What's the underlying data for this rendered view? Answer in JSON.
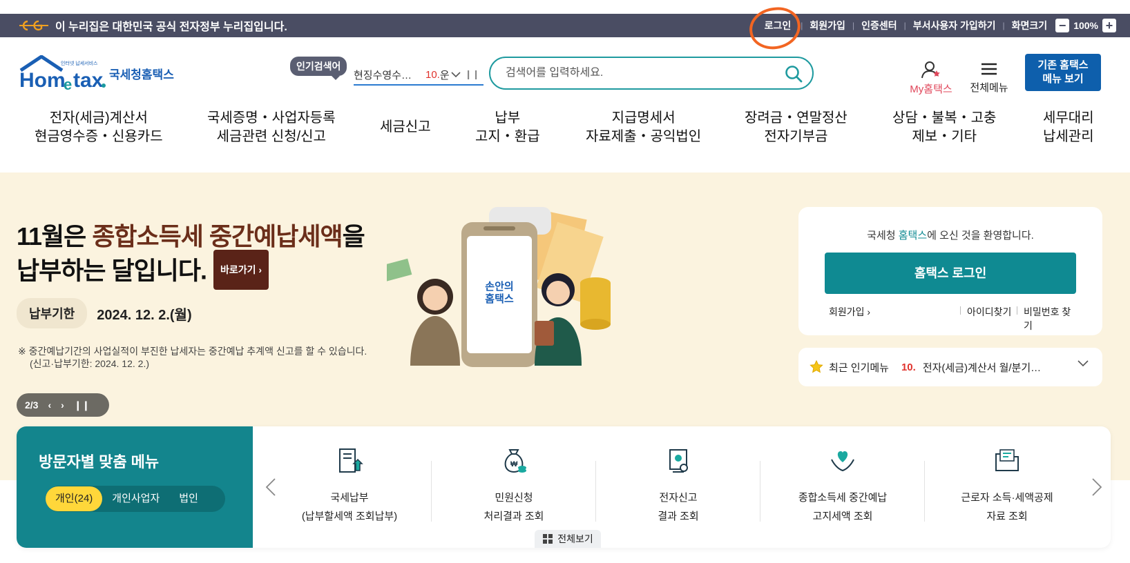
{
  "gov_banner": {
    "text": "이 누리집은 대한민국 공식 전자정부 누리집입니다.",
    "links": [
      "로그인",
      "회원가입",
      "인증센터",
      "부서사용자 가입하기",
      "화면크기"
    ],
    "zoom": "100%",
    "zoom_minus": "−",
    "zoom_plus": "+"
  },
  "header": {
    "popular_label": "인기검색어",
    "popular_current_text": "현징수영수…",
    "popular_current_rank": "10.",
    "popular_current_extra": "운",
    "search_placeholder": "검색어를 입력하세요.",
    "my_hometax": "My홈택스",
    "all_menu": "전체메뉴",
    "old_menu_line1": "기존 홈택스",
    "old_menu_line2": "메뉴 보기"
  },
  "main_nav": [
    {
      "l1": "전자(세금)계산서",
      "l2": "현금영수증・신용카드"
    },
    {
      "l1": "국세증명・사업자등록",
      "l2": "세금관련 신청/신고"
    },
    {
      "l1": "세금신고",
      "l2": ""
    },
    {
      "l1": "납부",
      "l2": "고지・환급"
    },
    {
      "l1": "지급명세서",
      "l2": "자료제출・공익법인"
    },
    {
      "l1": "장려금・연말정산",
      "l2": "전자기부금"
    },
    {
      "l1": "상담・불복・고충",
      "l2": "제보・기타"
    },
    {
      "l1": "세무대리",
      "l2": "납세관리"
    }
  ],
  "hero": {
    "title_line1_a": "11월은 ",
    "title_line1_b": "종합소득세 중간예납세액",
    "title_line1_c": "을",
    "title_line2": "납부하는 달입니다.",
    "go_label": "바로가기",
    "deadline_label": "납부기한",
    "deadline_value": "2024. 12. 2.(월)",
    "note_line1": "※ 중간예납기간의 사업실적이 부진한 납세자는 중간예납 추계액 신고를 할 수 있습니다.",
    "note_line2": "(신고·납부기한: 2024. 12. 2.)",
    "slide_counter": "2/3",
    "phone_text_1": "손안의",
    "phone_text_2": "홈택스"
  },
  "login_panel": {
    "welcome_a": "국세청 ",
    "welcome_b": "홈택스",
    "welcome_c": "에 오신 것을 환영합니다.",
    "login_button": "홈택스 로그인",
    "join": "회원가입",
    "find_id": "아이디찾기",
    "find_pw": "비밀번호 찾기"
  },
  "popular_menu": {
    "label": "최근 인기메뉴",
    "rank": "10.",
    "text": "전자(세금)계산서 월/분기…"
  },
  "visitor_menu": {
    "title": "방문자별 맞춤 메뉴",
    "tabs": [
      "개인(24)",
      "개인사업자",
      "법인"
    ],
    "services": [
      {
        "l1": "국세납부",
        "l2": "(납부할세액 조회납부)",
        "icon": "tax-payment-icon"
      },
      {
        "l1": "민원신청",
        "l2": "처리결과 조회",
        "icon": "money-bag-icon"
      },
      {
        "l1": "전자신고",
        "l2": "결과 조회",
        "icon": "certificate-icon"
      },
      {
        "l1": "종합소득세 중간예납",
        "l2": "고지세액 조회",
        "icon": "heart-hands-icon"
      },
      {
        "l1": "근로자 소득·세액공제",
        "l2": "자료 조회",
        "icon": "folder-icon"
      }
    ],
    "view_all": "전체보기"
  },
  "colors": {
    "gov_bar": "#4a4d63",
    "teal": "#0f8a92",
    "navy_button": "#0e5fac",
    "hero_bg": "#fbf3df",
    "highlight_circle": "#f26522"
  }
}
